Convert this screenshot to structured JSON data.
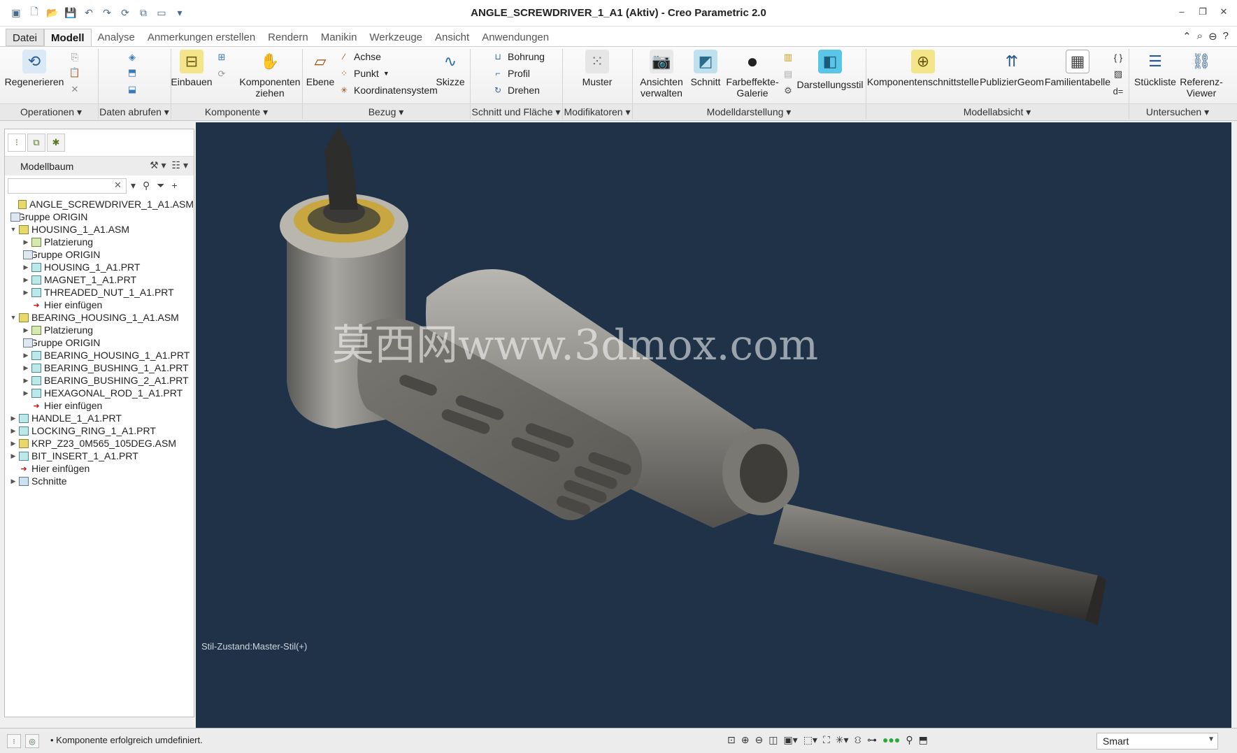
{
  "window": {
    "title": "ANGLE_SCREWDRIVER_1_A1 (Aktiv) - Creo Parametric 2.0"
  },
  "tabs": [
    {
      "label": "Datei",
      "active": false
    },
    {
      "label": "Modell",
      "active": true
    },
    {
      "label": "Analyse",
      "active": false
    },
    {
      "label": "Anmerkungen erstellen",
      "active": false
    },
    {
      "label": "Rendern",
      "active": false
    },
    {
      "label": "Manikin",
      "active": false
    },
    {
      "label": "Werkzeuge",
      "active": false
    },
    {
      "label": "Ansicht",
      "active": false
    },
    {
      "label": "Anwendungen",
      "active": false
    }
  ],
  "ribbon": {
    "regenerieren": "Regenerieren",
    "einbauen": "Einbauen",
    "komponenten": "Komponenten",
    "ziehen": "ziehen",
    "ebene": "Ebene",
    "achse": "Achse",
    "punkt": "Punkt",
    "koordinatensystem": "Koordinatensystem",
    "skizze": "Skizze",
    "bohrung": "Bohrung",
    "profil": "Profil",
    "drehen": "Drehen",
    "muster": "Muster",
    "ansichten": "Ansichten",
    "verwalten": "verwalten",
    "schnitt": "Schnitt",
    "farbeffekte": "Farbeffekte-",
    "galerie": "Galerie",
    "darstellungsstil": "Darstellungsstil",
    "komponentenschnittstelle": "Komponentenschnittstelle",
    "publiziergeom": "PublizierGeom",
    "familientabelle": "Familientabelle",
    "stueckliste": "Stückliste",
    "referenz": "Referenz-",
    "viewer": "Viewer"
  },
  "groups": [
    "Operationen",
    "Daten abrufen",
    "Komponente",
    "Bezug",
    "Schnitt und Fläche",
    "Modifikatoren",
    "Modelldarstellung",
    "Modellabsicht",
    "Untersuchen"
  ],
  "panel": {
    "title": "Modellbaum",
    "tree": [
      {
        "label": "ANGLE_SCREWDRIVER_1_A1.ASM",
        "icon": "asm",
        "level": 0,
        "toggle": ""
      },
      {
        "label": "Gruppe ORIGIN",
        "icon": "grp",
        "level": 0,
        "toggle": "▶"
      },
      {
        "label": "HOUSING_1_A1.ASM",
        "icon": "asm",
        "level": 0,
        "toggle": "▼"
      },
      {
        "label": "Platzierung",
        "icon": "plz",
        "level": 1,
        "toggle": "▶"
      },
      {
        "label": "Gruppe ORIGIN",
        "icon": "grp",
        "level": 1,
        "toggle": "▶"
      },
      {
        "label": "HOUSING_1_A1.PRT",
        "icon": "prt",
        "level": 1,
        "toggle": "▶"
      },
      {
        "label": "MAGNET_1_A1.PRT",
        "icon": "prt",
        "level": 1,
        "toggle": "▶"
      },
      {
        "label": "THREADED_NUT_1_A1.PRT",
        "icon": "prt",
        "level": 1,
        "toggle": "▶"
      },
      {
        "label": "Hier einfügen",
        "icon": "ins",
        "level": 1,
        "toggle": ""
      },
      {
        "label": "BEARING_HOUSING_1_A1.ASM",
        "icon": "asm",
        "level": 0,
        "toggle": "▼"
      },
      {
        "label": "Platzierung",
        "icon": "plz",
        "level": 1,
        "toggle": "▶"
      },
      {
        "label": "Gruppe ORIGIN",
        "icon": "grp",
        "level": 1,
        "toggle": "▶"
      },
      {
        "label": "BEARING_HOUSING_1_A1.PRT",
        "icon": "prt",
        "level": 1,
        "toggle": "▶"
      },
      {
        "label": "BEARING_BUSHING_1_A1.PRT",
        "icon": "prt",
        "level": 1,
        "toggle": "▶"
      },
      {
        "label": "BEARING_BUSHING_2_A1.PRT",
        "icon": "prt",
        "level": 1,
        "toggle": "▶"
      },
      {
        "label": "HEXAGONAL_ROD_1_A1.PRT",
        "icon": "prt",
        "level": 1,
        "toggle": "▶"
      },
      {
        "label": "Hier einfügen",
        "icon": "ins",
        "level": 1,
        "toggle": ""
      },
      {
        "label": "HANDLE_1_A1.PRT",
        "icon": "prt",
        "level": 0,
        "toggle": "▶"
      },
      {
        "label": "LOCKING_RING_1_A1.PRT",
        "icon": "prt",
        "level": 0,
        "toggle": "▶"
      },
      {
        "label": "KRP_Z23_0M565_105DEG.ASM",
        "icon": "asm",
        "level": 0,
        "toggle": "▶"
      },
      {
        "label": "BIT_INSERT_1_A1.PRT",
        "icon": "prt",
        "level": 0,
        "toggle": "▶"
      },
      {
        "label": "Hier einfügen",
        "icon": "ins",
        "level": 0,
        "toggle": ""
      },
      {
        "label": "Schnitte",
        "icon": "sec",
        "level": 0,
        "toggle": "▶"
      }
    ]
  },
  "viewport": {
    "watermark": "莫西网www.3dmox.com",
    "style_state": "Stil-Zustand:Master-Stil(+)"
  },
  "status": {
    "message": "Komponente erfolgreich umdefiniert.",
    "filter": "Smart"
  }
}
